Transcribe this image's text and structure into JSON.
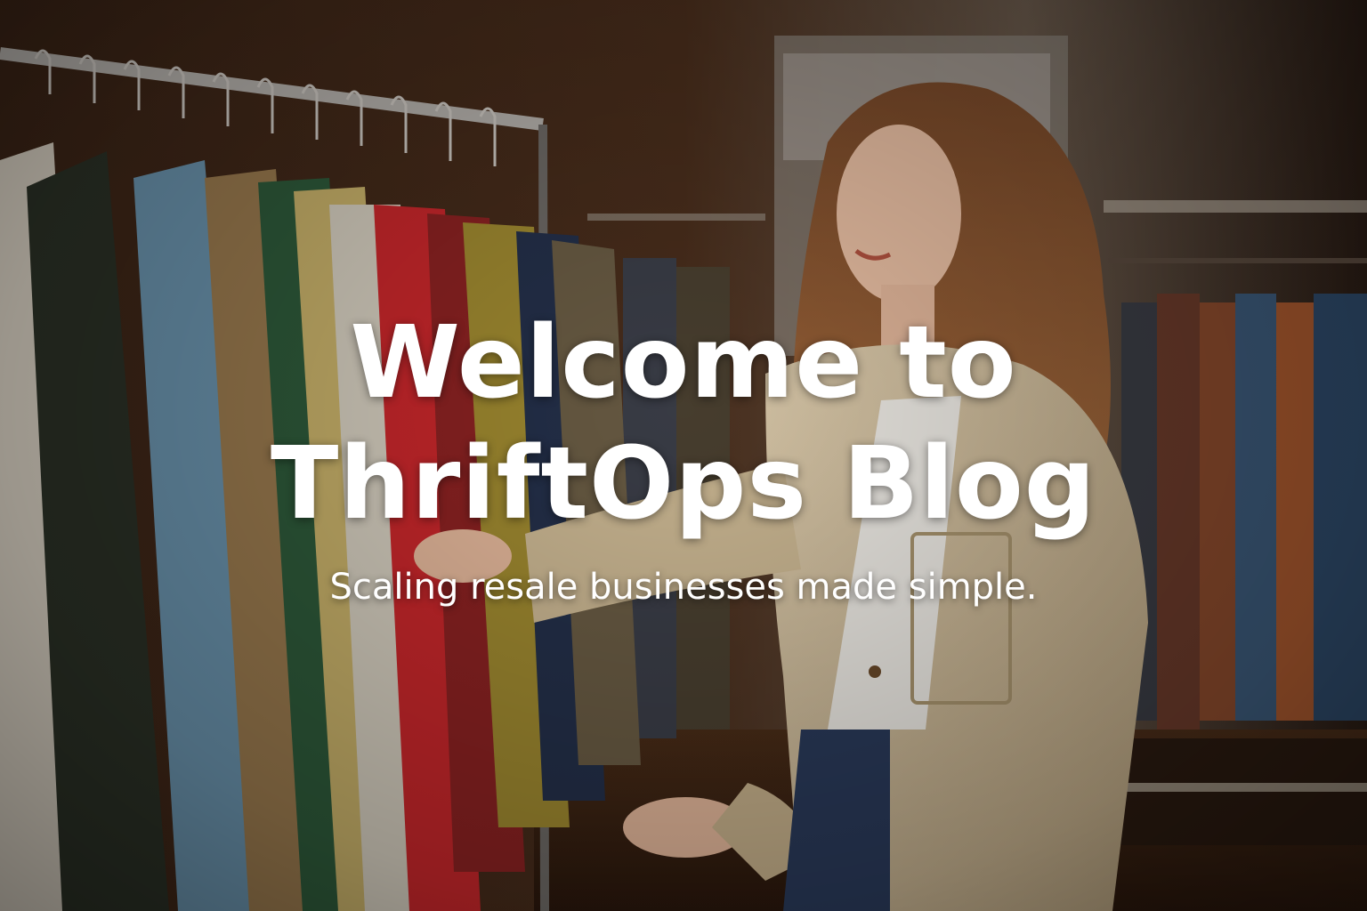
{
  "hero": {
    "title_line_1": "Welcome to",
    "title_line_2": "ThriftOps Blog",
    "subtitle": "Scaling resale businesses made simple."
  },
  "colors": {
    "text": "#ffffff",
    "background_warm": "#3a2415",
    "jacket_beige": "#d2bf9f"
  }
}
